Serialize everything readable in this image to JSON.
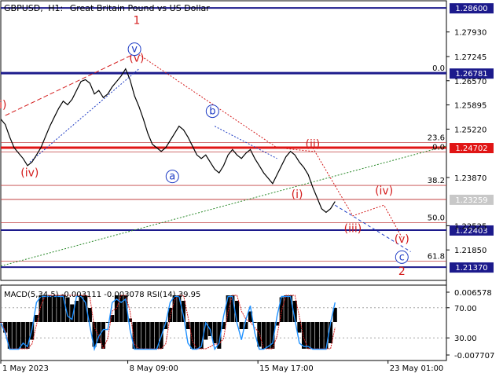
{
  "header": {
    "symbol": "GBPUSD",
    "timeframe": "H1:",
    "description": "Great Britain Pound vs US Dollar"
  },
  "colors": {
    "red_line": "#e01515",
    "navy_line": "#1c1a8c",
    "blue_label": "#1d3bc4",
    "wave_red": "#d41c1c",
    "green_dotted": "#2a8a2a",
    "macd_hist": "#000000",
    "macd_signal": "#d41c1c",
    "rsi_line": "#1e90ff"
  },
  "chart_data": [
    {
      "type": "line",
      "name": "price",
      "y_range": [
        1.21,
        1.288
      ],
      "x_range": [
        0,
        100
      ],
      "y_ticks": [
        "1.27930",
        "1.27245",
        "1.26570",
        "1.25895",
        "1.25220",
        "1.23870",
        "1.22525",
        "1.21850"
      ],
      "x_ticks": [
        {
          "label": "1 May 2023",
          "x": 0
        },
        {
          "label": "8 May 09:00",
          "x": 28.5
        },
        {
          "label": "15 May 17:00",
          "x": 57.7
        },
        {
          "label": "23 May 01:00",
          "x": 86.9
        }
      ],
      "levels": [
        {
          "value": 1.286,
          "label": "1.28600",
          "kind": "navy",
          "width": 2
        },
        {
          "value": 1.26781,
          "label": "1.26781",
          "kind": "navy",
          "width": 3
        },
        {
          "value": 1.24702,
          "label": "1.24702",
          "kind": "red",
          "width": 3
        },
        {
          "value": 1.23259,
          "label": "1.23259",
          "kind": "current",
          "width": 1
        },
        {
          "value": 1.22403,
          "label": "1.22403",
          "kind": "navy",
          "width": 2
        },
        {
          "value": 1.2137,
          "label": "1.21370",
          "kind": "navy",
          "width": 2
        }
      ],
      "fibonacci": [
        {
          "value": 1.26781,
          "label": "0.0"
        },
        {
          "value": 1.24845,
          "label": "23.6"
        },
        {
          "value": 1.2458,
          "label": "0.0"
        },
        {
          "value": 1.2365,
          "label": "38.2"
        },
        {
          "value": 1.2261,
          "label": "50.0"
        },
        {
          "value": 1.2154,
          "label": "61.8"
        }
      ],
      "price_points": [
        [
          0,
          1.255
        ],
        [
          1,
          1.2535
        ],
        [
          2,
          1.25
        ],
        [
          3,
          1.247
        ],
        [
          4,
          1.2455
        ],
        [
          5,
          1.244
        ],
        [
          6,
          1.242
        ],
        [
          7,
          1.243
        ],
        [
          8,
          1.245
        ],
        [
          9,
          1.247
        ],
        [
          10,
          1.25
        ],
        [
          11,
          1.253
        ],
        [
          12,
          1.2555
        ],
        [
          13,
          1.258
        ],
        [
          14,
          1.26
        ],
        [
          15,
          1.259
        ],
        [
          16,
          1.2605
        ],
        [
          17,
          1.263
        ],
        [
          18,
          1.2655
        ],
        [
          19,
          1.266
        ],
        [
          20,
          1.265
        ],
        [
          21,
          1.262
        ],
        [
          22,
          1.263
        ],
        [
          23,
          1.261
        ],
        [
          24,
          1.262
        ],
        [
          25,
          1.264
        ],
        [
          26,
          1.2655
        ],
        [
          27,
          1.267
        ],
        [
          28,
          1.269
        ],
        [
          29,
          1.266
        ],
        [
          30,
          1.2615
        ],
        [
          31,
          1.2585
        ],
        [
          32,
          1.255
        ],
        [
          33,
          1.251
        ],
        [
          34,
          1.248
        ],
        [
          35,
          1.247
        ],
        [
          36,
          1.246
        ],
        [
          37,
          1.247
        ],
        [
          38,
          1.249
        ],
        [
          39,
          1.251
        ],
        [
          40,
          1.253
        ],
        [
          41,
          1.252
        ],
        [
          42,
          1.25
        ],
        [
          43,
          1.2475
        ],
        [
          44,
          1.245
        ],
        [
          45,
          1.244
        ],
        [
          46,
          1.245
        ],
        [
          47,
          1.243
        ],
        [
          48,
          1.241
        ],
        [
          49,
          1.24
        ],
        [
          50,
          1.242
        ],
        [
          51,
          1.245
        ],
        [
          52,
          1.2465
        ],
        [
          53,
          1.245
        ],
        [
          54,
          1.244
        ],
        [
          55,
          1.2455
        ],
        [
          56,
          1.2465
        ],
        [
          57,
          1.244
        ],
        [
          58,
          1.242
        ],
        [
          59,
          1.24
        ],
        [
          60,
          1.2385
        ],
        [
          61,
          1.237
        ],
        [
          62,
          1.2395
        ],
        [
          63,
          1.242
        ],
        [
          64,
          1.2445
        ],
        [
          65,
          1.246
        ],
        [
          66,
          1.245
        ],
        [
          67,
          1.243
        ],
        [
          68,
          1.2415
        ],
        [
          69,
          1.2395
        ],
        [
          70,
          1.236
        ],
        [
          71,
          1.233
        ],
        [
          72,
          1.23
        ],
        [
          73,
          1.229
        ],
        [
          74,
          1.23
        ],
        [
          75,
          1.232
        ]
      ],
      "elliott_labels_red": [
        {
          "text": "1",
          "x": 30.5,
          "y": 1.2815
        },
        {
          "text": "(v)",
          "x": 30.5,
          "y": 1.271
        },
        {
          "text": "(iv)",
          "x": 6.5,
          "y": 1.239
        },
        {
          "text": "(ii)",
          "x": 70,
          "y": 1.247
        },
        {
          "text": "(i)",
          "x": 66.5,
          "y": 1.233
        },
        {
          "text": "(iii)",
          "x": 79,
          "y": 1.2235
        },
        {
          "text": "(iv)",
          "x": 86,
          "y": 1.234
        },
        {
          "text": "(v)",
          "x": 90,
          "y": 1.2205
        },
        {
          "text": "2",
          "x": 90,
          "y": 1.2115
        },
        {
          "text": "i)",
          "x": 0.5,
          "y": 1.258
        }
      ],
      "elliott_labels_blue_circled": [
        {
          "text": "v",
          "x": 30,
          "y": 1.2745
        },
        {
          "text": "b",
          "x": 47.5,
          "y": 1.2572
        },
        {
          "text": "a",
          "x": 38.5,
          "y": 1.239
        },
        {
          "text": "c",
          "x": 90,
          "y": 1.2165
        }
      ]
    },
    {
      "type": "line",
      "name": "indicators",
      "title": "MACD(5,34,5) -0.003111 -0.003078 RSI(14) 39.95",
      "y_ticks_right": [
        "0.006578",
        "70.00",
        "30.00",
        "-0.007707"
      ],
      "rsi_levels": [
        70,
        30
      ]
    }
  ]
}
